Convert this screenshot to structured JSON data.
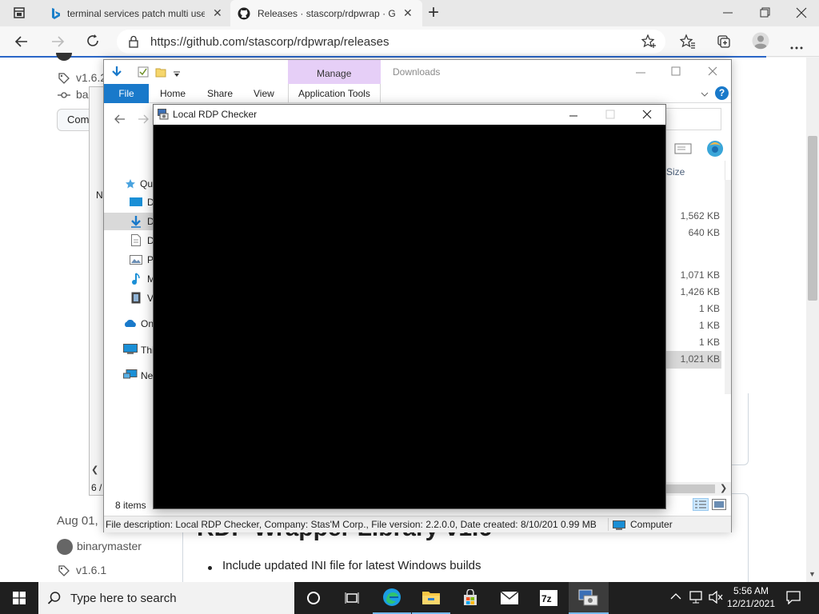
{
  "browser": {
    "tabs": [
      {
        "title": "terminal services patch multi use",
        "close": "✕"
      },
      {
        "title": "Releases · stascorp/rdpwrap · Git",
        "close": "✕"
      }
    ],
    "new_tab": "+",
    "url": "https://github.com/stascorp/rdpwrap/releases"
  },
  "page": {
    "version_top": "v1.6.2",
    "tag_partial": "ba",
    "compare_partial": "Comp",
    "release_date": "Aug 01,",
    "author": "binarymaster",
    "version_bottom": "v1.6.1",
    "heading": "RDP Wrapper Library v1.6",
    "bullet": "Include updated INI file for latest Windows builds",
    "list_header_partial": "N",
    "status_partial": "6 /"
  },
  "explorer": {
    "ribbon": {
      "file": "File",
      "home": "Home",
      "share": "Share",
      "view": "View",
      "manage": "Manage",
      "app_tools": "Application Tools",
      "downloads": "Downloads"
    },
    "nav_items": [
      "Qu",
      "D",
      "D",
      "D",
      "P",
      "M",
      "V",
      "On",
      "Thi",
      "Ne"
    ],
    "column_size": "Size",
    "sizes": [
      "1,562 KB",
      "640 KB",
      "1,071 KB",
      "1,426 KB",
      "1 KB",
      "1 KB",
      "1 KB",
      "1,021 KB"
    ],
    "items_count": "8 items",
    "status_description": "File description: Local RDP Checker, Company: Stas'M Corp., File version: 2.2.0.0, Date created: 8/10/201 0.99 MB",
    "status_location": "Computer"
  },
  "rdp_checker": {
    "title": "Local RDP Checker"
  },
  "taskbar": {
    "search_placeholder": "Type here to search",
    "time": "5:56 AM",
    "date": "12/21/2021"
  },
  "colors": {
    "accent": "#1979ca",
    "manage_tab": "#e6cff7",
    "taskbar": "#1f1f1f",
    "selected_row": "#cce8ff"
  }
}
